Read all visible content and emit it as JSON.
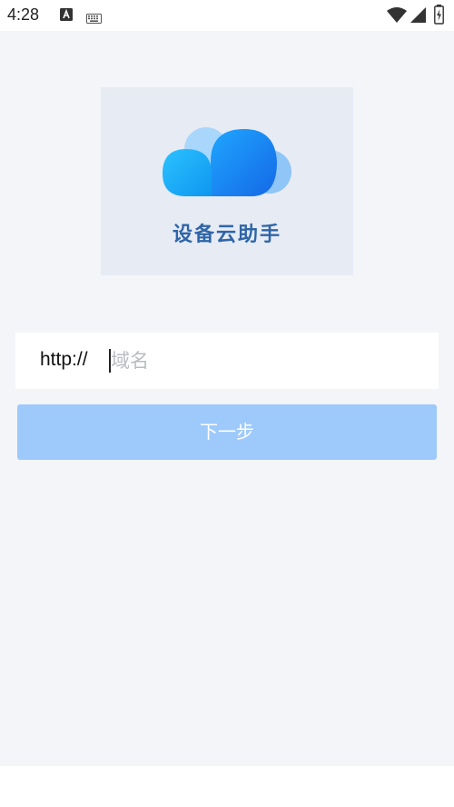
{
  "status_bar": {
    "time": "4:28",
    "icons": [
      "notification-a-icon",
      "keyboard-icon",
      "wifi-icon",
      "signal-icon",
      "battery-charging-icon"
    ]
  },
  "logo": {
    "app_name": "设备云助手",
    "icon": "cloud-icon",
    "colors": {
      "card_bg": "#e6ebf4",
      "text": "#2f65a8",
      "cloud_front": "#1a8cf2",
      "cloud_back": "#8fc5f7"
    }
  },
  "url_field": {
    "prefix": "http://",
    "value": "",
    "placeholder": "域名"
  },
  "next_button": {
    "label": "下一步",
    "color": "#9ec9fb"
  }
}
